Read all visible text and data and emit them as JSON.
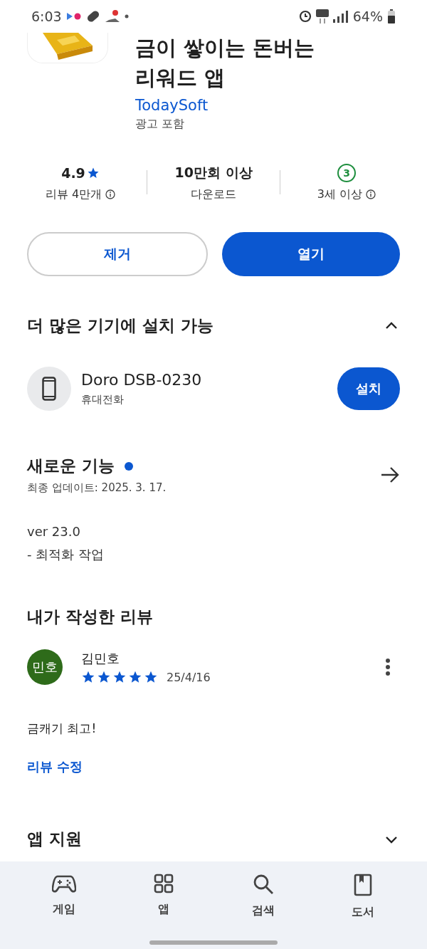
{
  "status_bar": {
    "time": "6:03",
    "battery": "64%"
  },
  "app": {
    "title_lines": [
      "금이 쌓이는 돈버는",
      "리워드 앱"
    ],
    "developer": "TodaySoft",
    "ads_note": "광고 포함"
  },
  "stats": [
    {
      "kind": "rating",
      "value": "4.9",
      "label": "리뷰 4만개",
      "info": true
    },
    {
      "kind": "text",
      "value": "10만회 이상",
      "label": "다운로드",
      "info": false
    },
    {
      "kind": "age",
      "value": "3",
      "label": "3세 이상",
      "info": true
    }
  ],
  "actions": [
    {
      "label": "제거",
      "kind": "outline"
    },
    {
      "label": "열기",
      "kind": "filled"
    }
  ],
  "devices_section": {
    "title": "더 많은 기기에 설치 가능",
    "expanded": true,
    "device": {
      "name": "Doro DSB-0230",
      "type": "휴대전화",
      "button": "설치"
    }
  },
  "whats_new": {
    "title": "새로운 기능",
    "new_dot": true,
    "updated": "최종 업데이트: 2025. 3. 17.",
    "lines": [
      "ver 23.0",
      "- 최적화 작업"
    ]
  },
  "my_review": {
    "title": "내가 작성한 리뷰",
    "avatar": "민호",
    "color": "#2e6b1a",
    "name": "김민호",
    "stars": 5,
    "date": "25/4/16",
    "text": "금캐기 최고!",
    "edit_link": "리뷰 수정"
  },
  "app_support": {
    "title": "앱 지원",
    "expanded": false
  },
  "bottom_nav": [
    {
      "label": "게임",
      "selected": false
    },
    {
      "label": "앱",
      "selected": false
    },
    {
      "label": "검색",
      "selected": false
    },
    {
      "label": "도서",
      "selected": false
    }
  ]
}
